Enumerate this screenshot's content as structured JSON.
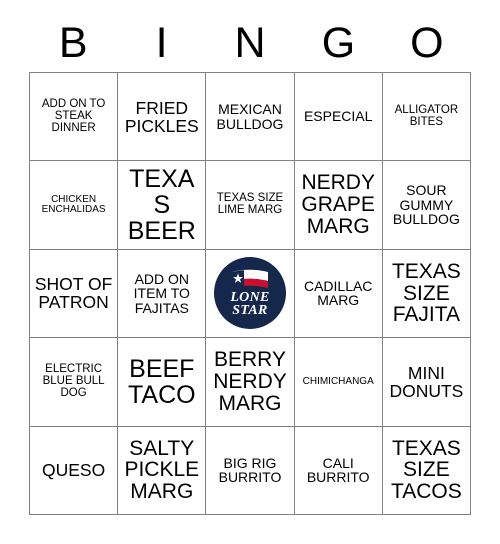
{
  "card": {
    "title": "BINGO Card",
    "header_letters": [
      "B",
      "I",
      "N",
      "G",
      "O"
    ],
    "colors": {
      "grid_border": "#808080",
      "text": "#000000",
      "background": "#ffffff",
      "logo_navy": "#15284b",
      "logo_red": "#c8102e",
      "logo_white": "#ffffff"
    },
    "free_space": {
      "type": "logo",
      "brand_line1": "LONE",
      "brand_line2": "STAR",
      "icon": "texas-flag-icon"
    },
    "rows": [
      [
        {
          "text": "ADD ON TO STEAK DINNER",
          "size": "xs"
        },
        {
          "text": "FRIED PICKLES",
          "size": "md"
        },
        {
          "text": "MEXICAN BULLDOG",
          "size": "sm"
        },
        {
          "text": "ESPECIAL",
          "size": "sm"
        },
        {
          "text": "ALLIGATOR BITES",
          "size": "xs"
        }
      ],
      [
        {
          "text": "CHICKEN ENCHALIDAS",
          "size": "xxs"
        },
        {
          "text": "TEXAS BEER",
          "size": "xl"
        },
        {
          "text": "TEXAS SIZE LIME MARG",
          "size": "xs"
        },
        {
          "text": "NERDY GRAPE MARG",
          "size": "lg"
        },
        {
          "text": "SOUR GUMMY BULLDOG",
          "size": "sm"
        }
      ],
      [
        {
          "text": "SHOT OF PATRON",
          "size": "md"
        },
        {
          "text": "ADD ON ITEM TO FAJITAS",
          "size": "sm"
        },
        {
          "text": "",
          "size": "free"
        },
        {
          "text": "CADILLAC MARG",
          "size": "sm"
        },
        {
          "text": "TEXAS SIZE FAJITA",
          "size": "lg"
        }
      ],
      [
        {
          "text": "ELECTRIC BLUE BULL DOG",
          "size": "xs"
        },
        {
          "text": "BEEF TACO",
          "size": "xl"
        },
        {
          "text": "BERRY NERDY MARG",
          "size": "lg"
        },
        {
          "text": "CHIMICHANGA",
          "size": "xxs"
        },
        {
          "text": "MINI DONUTS",
          "size": "md"
        }
      ],
      [
        {
          "text": "QUESO",
          "size": "md"
        },
        {
          "text": "SALTY PICKLE MARG",
          "size": "lg"
        },
        {
          "text": "BIG RIG BURRITO",
          "size": "sm"
        },
        {
          "text": "CALI BURRITO",
          "size": "sm"
        },
        {
          "text": "TEXAS SIZE TACOS",
          "size": "lg"
        }
      ]
    ]
  }
}
